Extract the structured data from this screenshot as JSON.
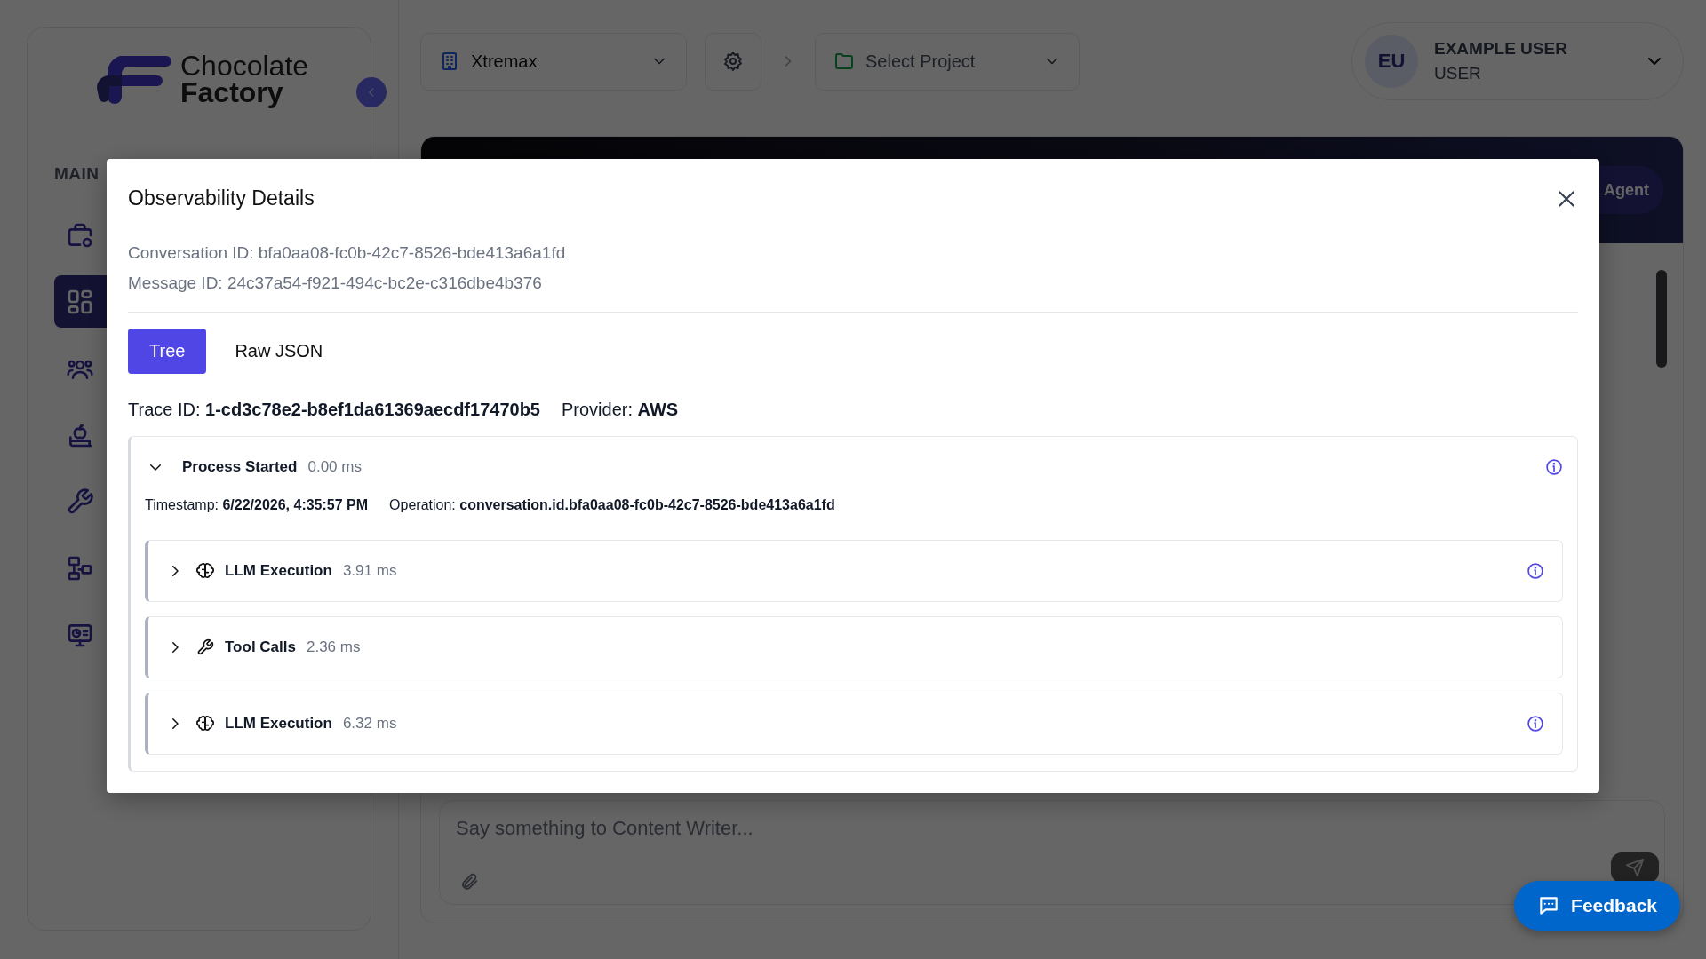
{
  "sidebar": {
    "logo": {
      "line_1": "Chocolate",
      "line_2": "Factory"
    },
    "section_label": "MAIN",
    "items": [
      {
        "kind": "briefcase",
        "selected": false
      },
      {
        "kind": "grid",
        "selected": true
      },
      {
        "kind": "users",
        "selected": false
      },
      {
        "kind": "apple-book",
        "selected": false
      },
      {
        "kind": "wrench",
        "selected": false
      },
      {
        "kind": "flow",
        "selected": false
      },
      {
        "kind": "monitor",
        "selected": false
      }
    ]
  },
  "topbar": {
    "organization": {
      "label": "Xtremax"
    },
    "project": {
      "label": "Select Project"
    },
    "user": {
      "initials": "EU",
      "name": "EXAMPLE USER",
      "role": "USER"
    }
  },
  "banner": {
    "button": "Agent"
  },
  "chat": {
    "placeholder": "Say something to Content Writer..."
  },
  "feedback": {
    "label": "Feedback"
  },
  "modal": {
    "title": "Observability Details",
    "ids": [
      "Conversation ID: bfa0aa08-fc0b-42c7-8526-bde413a6a1fd",
      "Message ID: 24c37a54-f921-494c-bc2e-c316dbe4b376"
    ],
    "tabs": [
      {
        "label": "Tree",
        "selected": true
      },
      {
        "label": "Raw JSON",
        "selected": false
      }
    ],
    "trace": [
      "Trace ID: **1-cd3c78e2-b8ef1da61369aecdf17470b5**",
      "Provider: **AWS**"
    ],
    "root": {
      "title": "Process Started",
      "duration": "0.00 ms",
      "expanded": true,
      "info": true,
      "details": [
        "Timestamp: **6/22/2026, 4:35:57 PM**",
        "Operation: **conversation.id.bfa0aa08-fc0b-42c7-8526-bde413a6a1fd**"
      ],
      "children": [
        {
          "kind": "llm",
          "title": "LLM Execution",
          "duration": "3.91 ms",
          "expanded": false,
          "info": true
        },
        {
          "kind": "tool",
          "title": "Tool Calls",
          "duration": "2.36 ms",
          "expanded": false,
          "info": false
        },
        {
          "kind": "llm",
          "title": "LLM Execution",
          "duration": "6.32 ms",
          "expanded": false,
          "info": true
        }
      ]
    }
  }
}
